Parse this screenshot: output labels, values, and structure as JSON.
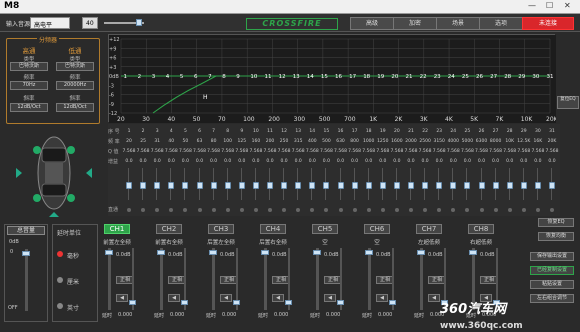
{
  "window": {
    "title": "M8",
    "controls": [
      "—",
      "☐",
      "✕"
    ]
  },
  "toolbar": {
    "input_source_label": "输入音源",
    "input_source_value": "高电平",
    "input_num": "40",
    "brand": "CROSSFIRE",
    "buttons": [
      "高级",
      "加密",
      "场景",
      "选项"
    ],
    "connect_btn": "未连接"
  },
  "crossover": {
    "title": "分频器",
    "hp_title": "高通",
    "lp_title": "低通",
    "type_label": "类型",
    "type_hp": "巴特沃斯",
    "type_lp": "巴特沃斯",
    "freq_label": "频率",
    "freq_hp": "70Hz",
    "freq_lp": "20000Hz",
    "slope_label": "斜率",
    "slope_hp": "12dB/Oct",
    "slope_lp": "12dB/Oct"
  },
  "graph": {
    "y_ticks": [
      "+12",
      "+9",
      "+6",
      "+3",
      "0dB",
      "-3",
      "-6",
      "-9",
      "-12"
    ],
    "x_ticks": [
      "20",
      "30",
      "40",
      "50",
      "70",
      "100",
      "200",
      "300",
      "500",
      "700",
      "1K",
      "2K",
      "3K",
      "4K",
      "5K",
      "7K",
      "10K",
      "20K"
    ],
    "points": [
      "1",
      "2",
      "3",
      "4",
      "5",
      "6",
      "7",
      "8",
      "9",
      "10",
      "11",
      "12",
      "13",
      "14",
      "15",
      "16",
      "17",
      "18",
      "19",
      "20",
      "21",
      "22",
      "23",
      "24",
      "25",
      "26",
      "27",
      "28",
      "29",
      "30",
      "31"
    ],
    "hp_marker": "H",
    "reset": "复位EQ"
  },
  "eq": {
    "row_index": "序 号",
    "row_freq": "频 率",
    "row_q": "Q 值",
    "row_gain": "增益",
    "row_bypass": "直通",
    "index": [
      "1",
      "2",
      "3",
      "4",
      "5",
      "6",
      "7",
      "8",
      "9",
      "10",
      "11",
      "12",
      "13",
      "14",
      "15",
      "16",
      "17",
      "18",
      "19",
      "20",
      "21",
      "22",
      "23",
      "24",
      "25",
      "26",
      "27",
      "28",
      "29",
      "30",
      "31"
    ],
    "freq": [
      "20",
      "25",
      "31",
      "40",
      "50",
      "63",
      "80",
      "100",
      "125",
      "160",
      "200",
      "250",
      "315",
      "400",
      "500",
      "630",
      "800",
      "1000",
      "1250",
      "1600",
      "2000",
      "2500",
      "3150",
      "4000",
      "5000",
      "6300",
      "8000",
      "10K",
      "12.5K",
      "16K",
      "20K"
    ],
    "q": "7.568",
    "gain": "0.0"
  },
  "side": {
    "reset_eq": "恢复EQ",
    "restore_eq": "恢复均衡",
    "save_ch": "保存输出设置",
    "copy_ch": "已经复制设置",
    "paste": "粘贴设置",
    "linked": "左右组合调节"
  },
  "volume": {
    "title": "总音量",
    "value": "0dB",
    "max": "0",
    "min": "OFF"
  },
  "delay": {
    "title": "延时单位",
    "opt1": "毫秒",
    "opt2": "厘米",
    "opt3": "英寸"
  },
  "channels": [
    {
      "btn": "CH1",
      "name": "前置左全频",
      "db": "0.0dB",
      "delay": "0.000"
    },
    {
      "btn": "CH2",
      "name": "前置右全频",
      "db": "0.0dB",
      "delay": "0.000"
    },
    {
      "btn": "CH3",
      "name": "后置左全频",
      "db": "0.0dB",
      "delay": "0.000"
    },
    {
      "btn": "CH4",
      "name": "后置右全频",
      "db": "0.0dB",
      "delay": "0.000"
    },
    {
      "btn": "CH5",
      "name": "空",
      "db": "0.0dB",
      "delay": "0.000"
    },
    {
      "btn": "CH6",
      "name": "空",
      "db": "0.0dB",
      "delay": "0.000"
    },
    {
      "btn": "CH7",
      "name": "左超低频",
      "db": "0.0dB",
      "delay": "0.000"
    },
    {
      "btn": "CH8",
      "name": "右超低频",
      "db": "0.0dB",
      "delay": "0.000"
    }
  ],
  "ch_labels": {
    "phase": "正相",
    "delay": "延时"
  },
  "watermark": {
    "main": "360汽车网",
    "sub": "www.360qc.com"
  }
}
